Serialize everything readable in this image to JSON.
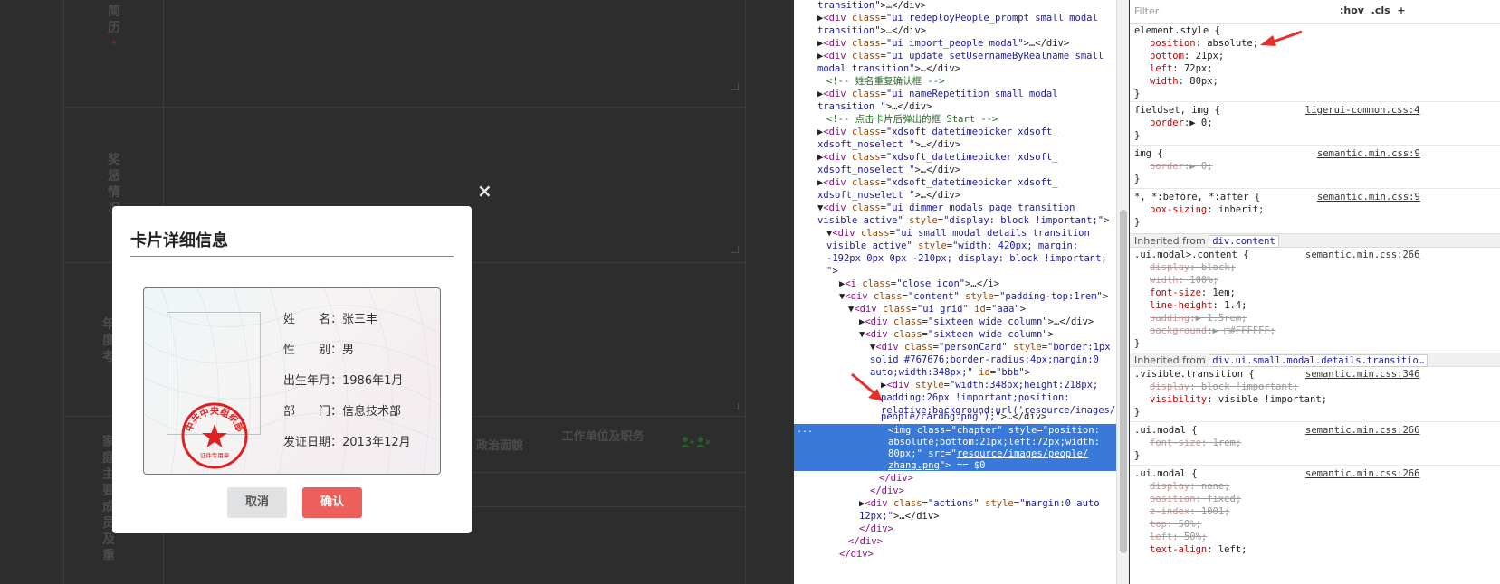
{
  "page": {
    "labels": {
      "resume": "简历",
      "awards": "奖惩情况",
      "annual": "年度考",
      "family": "家庭主要成员及重"
    },
    "required_mark": "*",
    "table_heads": {
      "politics": "政治面貌",
      "work_unit": "工作单位及职务"
    }
  },
  "modal": {
    "close_glyph": "×",
    "title": "卡片详细信息",
    "card": {
      "fields": [
        {
          "key": "姓　　名：",
          "value": "张三丰"
        },
        {
          "key": "性　　别：",
          "value": "男"
        },
        {
          "key": "出生年月：",
          "value": "1986年1月"
        },
        {
          "key": "部　　门：",
          "value": "信息技术部"
        },
        {
          "key": "发证日期：",
          "value": "2013年12月"
        }
      ],
      "seal_text": "中共中央组织部",
      "seal_sub": "证件专用章"
    },
    "buttons": {
      "cancel": "取消",
      "confirm": "确认"
    }
  },
  "devtools": {
    "selected_dots": "...",
    "styles": {
      "filter_placeholder": "Filter",
      "hov": ":hov",
      "cls": ".cls",
      "plus": "+"
    }
  },
  "colors": {
    "confirm_bg": "#ec5f5a",
    "selection": "#3879d9",
    "seal_red": "#e02020"
  }
}
